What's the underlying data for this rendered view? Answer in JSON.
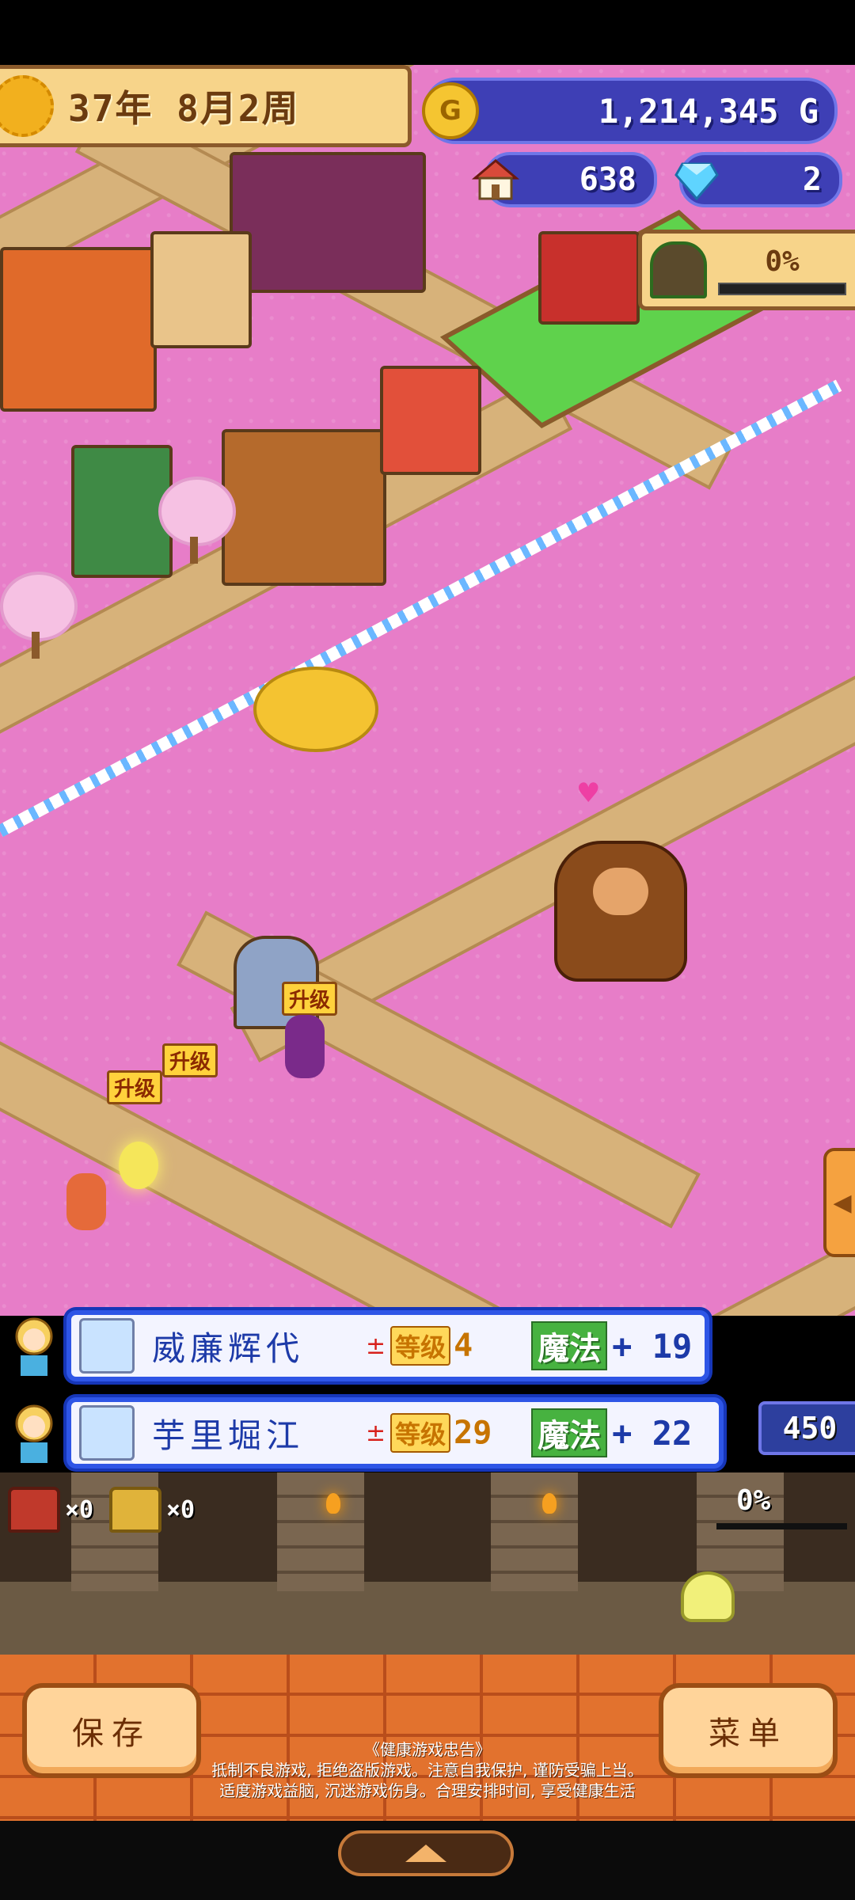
{
  "hud": {
    "date": "37年  8月2周",
    "gold": "1,214,345 G",
    "coin_symbol": "G",
    "population": "638",
    "gems": "2",
    "dungeon_progress": "0%",
    "dungeon_progress_value": 0
  },
  "map": {
    "upgrade_badges": [
      "升级",
      "升级",
      "升级"
    ]
  },
  "notifications": [
    {
      "name": "威廉辉代",
      "level_label": "等级",
      "level": "4",
      "stat_label": "魔法",
      "stat_value": "+ 19"
    },
    {
      "name": "芋里堀江",
      "level_label": "等级",
      "level": "29",
      "stat_label": "魔法",
      "stat_value": "+ 22"
    }
  ],
  "side_counter": "450",
  "dungeon": {
    "red_chest_count": "×0",
    "gold_chest_count": "×0",
    "progress": "0%"
  },
  "buttons": {
    "save": "保存",
    "menu": "菜单"
  },
  "health_notice": {
    "title": "《健康游戏忠告》",
    "line1": "抵制不良游戏, 拒绝盗版游戏。注意自我保护, 谨防受骗上当。",
    "line2": "适度游戏益脑, 沉迷游戏伤身。合理安排时间, 享受健康生活"
  },
  "colors": {
    "ground_pink": "#e77dc8",
    "road": "#d7b27a",
    "hud_blue": "#3e3fb5",
    "hud_gold": "#f7d48a",
    "brick": "#e2722e"
  },
  "icons": [
    "sunflower-icon",
    "gold-coin-icon",
    "house-icon",
    "crystal-gem-icon",
    "dungeon-gate-icon",
    "treasure-chest-icon",
    "gold-chest-icon",
    "arrow-left-icon",
    "arrow-up-icon"
  ]
}
